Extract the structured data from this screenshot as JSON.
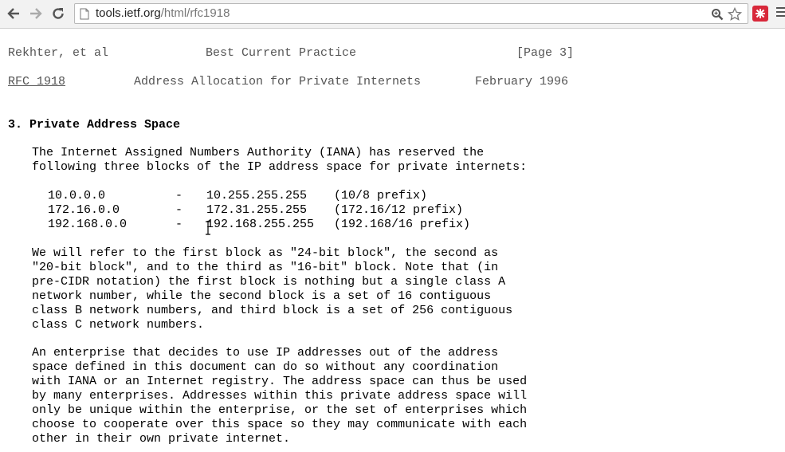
{
  "browser": {
    "url_host": "tools.ietf.org",
    "url_path": "/html/rfc1918",
    "icons": {
      "back": "back-arrow-icon",
      "forward": "forward-arrow-icon",
      "reload": "reload-icon",
      "page": "page-icon",
      "zoom": "zoom-icon",
      "bookmark": "star-icon",
      "extension": "extension-icon",
      "menu": "menu-icon"
    }
  },
  "header": {
    "author": "Rekhter, et al",
    "category": "Best Current Practice",
    "page": "[Page 3]",
    "rfc_link": "RFC 1918",
    "doc_title": "Address Allocation for Private Internets",
    "date": "February 1996"
  },
  "section": {
    "title": "3. Private Address Space",
    "intro": [
      "The Internet Assigned Numbers Authority (IANA) has reserved the",
      "following three blocks of the IP address space for private internets:"
    ],
    "blocks": [
      {
        "start": "10.0.0.0",
        "dash": "-",
        "end": "10.255.255.255",
        "prefix": "(10/8 prefix)"
      },
      {
        "start": "172.16.0.0",
        "dash": "-",
        "end": "172.31.255.255",
        "prefix": "(172.16/12 prefix)"
      },
      {
        "start": "192.168.0.0",
        "dash": "-",
        "end": "192.168.255.255",
        "prefix": "(192.168/16 prefix)"
      }
    ],
    "para2": [
      "We will refer to the first block as \"24-bit block\", the second as",
      "\"20-bit block\", and to the third as \"16-bit\" block. Note that (in",
      "pre-CIDR notation) the first block is nothing but a single class A",
      "network number, while the second block is a set of 16 contiguous",
      "class B network numbers, and third block is a set of 256 contiguous",
      "class C network numbers."
    ],
    "para3": [
      "An enterprise that decides to use IP addresses out of the address",
      "space defined in this document can do so without any coordination",
      "with IANA or an Internet registry. The address space can thus be used",
      "by many enterprises. Addresses within this private address space will",
      "only be unique within the enterprise, or the set of enterprises which",
      "choose to cooperate over this space so they may communicate with each",
      "other in their own private internet."
    ]
  }
}
